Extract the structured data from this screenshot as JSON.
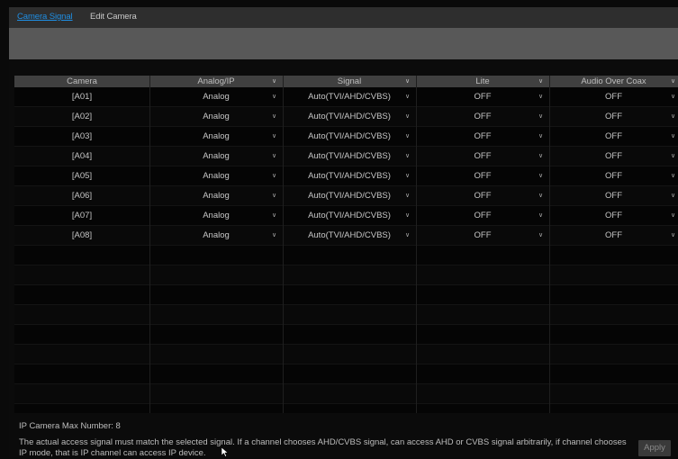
{
  "tabs": {
    "camera_signal": "Camera Signal",
    "edit_camera": "Edit Camera"
  },
  "table": {
    "headers": [
      "Camera",
      "Analog/IP",
      "Signal",
      "Lite",
      "Audio Over Coax"
    ],
    "rows": [
      {
        "camera": "[A01]",
        "analog_ip": "Analog",
        "signal": "Auto(TVI/AHD/CVBS)",
        "lite": "OFF",
        "audio": "OFF"
      },
      {
        "camera": "[A02]",
        "analog_ip": "Analog",
        "signal": "Auto(TVI/AHD/CVBS)",
        "lite": "OFF",
        "audio": "OFF"
      },
      {
        "camera": "[A03]",
        "analog_ip": "Analog",
        "signal": "Auto(TVI/AHD/CVBS)",
        "lite": "OFF",
        "audio": "OFF"
      },
      {
        "camera": "[A04]",
        "analog_ip": "Analog",
        "signal": "Auto(TVI/AHD/CVBS)",
        "lite": "OFF",
        "audio": "OFF"
      },
      {
        "camera": "[A05]",
        "analog_ip": "Analog",
        "signal": "Auto(TVI/AHD/CVBS)",
        "lite": "OFF",
        "audio": "OFF"
      },
      {
        "camera": "[A06]",
        "analog_ip": "Analog",
        "signal": "Auto(TVI/AHD/CVBS)",
        "lite": "OFF",
        "audio": "OFF"
      },
      {
        "camera": "[A07]",
        "analog_ip": "Analog",
        "signal": "Auto(TVI/AHD/CVBS)",
        "lite": "OFF",
        "audio": "OFF"
      },
      {
        "camera": "[A08]",
        "analog_ip": "Analog",
        "signal": "Auto(TVI/AHD/CVBS)",
        "lite": "OFF",
        "audio": "OFF"
      }
    ]
  },
  "footer": {
    "ip_camera_max": "IP Camera Max Number: 8",
    "note": "The actual access signal must match the selected signal. If a channel chooses AHD/CVBS signal, can access AHD or CVBS signal arbitrarily, if channel chooses IP mode, that is IP channel can access IP device.",
    "apply_label": "Apply"
  },
  "icons": {
    "dropdown": "chevron-down-icon",
    "cursor": "mouse-pointer-icon"
  },
  "colors": {
    "active_tab": "#1f8fe5",
    "tab_bar": "#2e2e2e",
    "toolbar": "#585858",
    "header": "#404040"
  }
}
